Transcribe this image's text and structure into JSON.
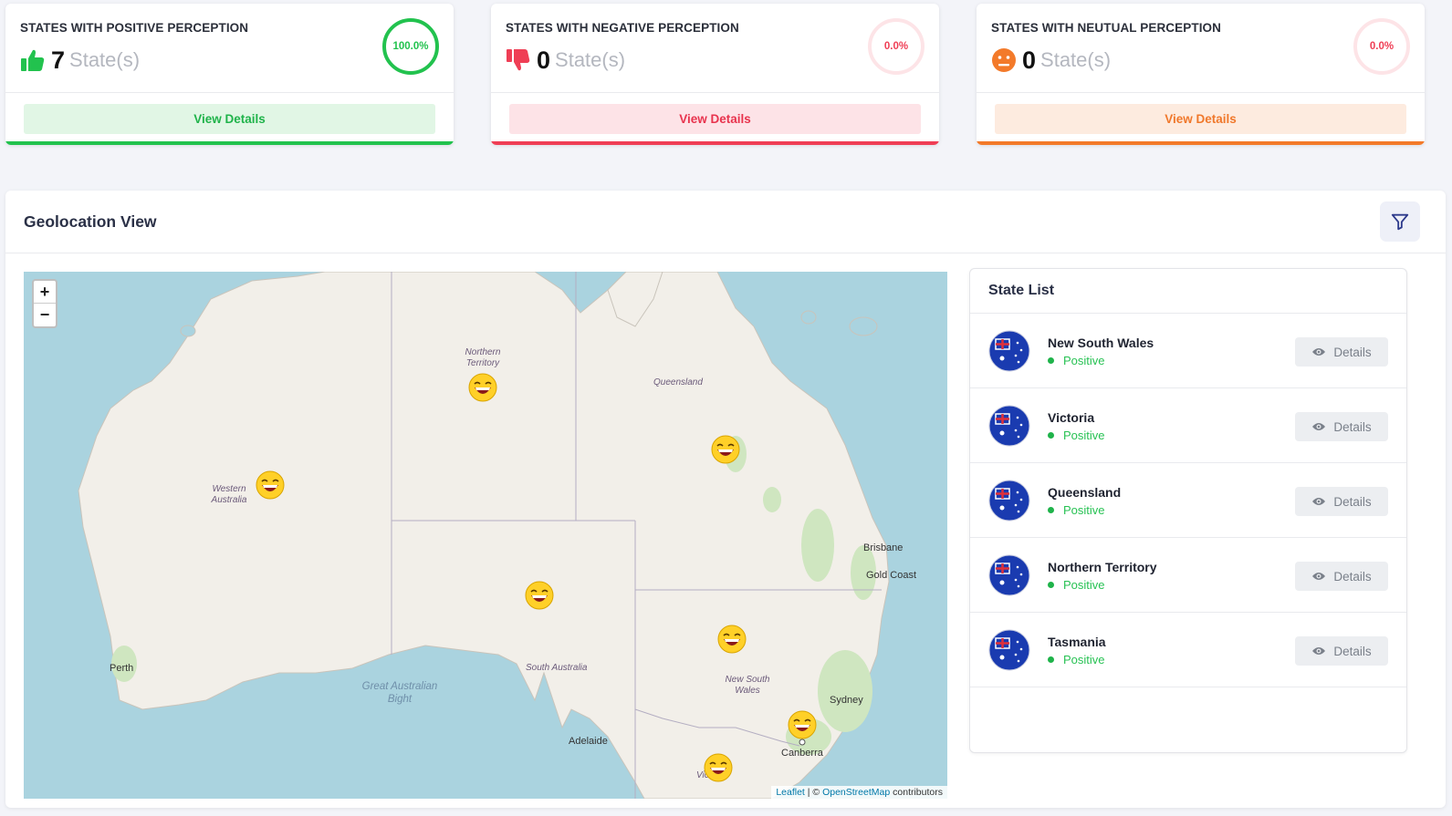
{
  "cards": [
    {
      "title": "STATES WITH POSITIVE PERCEPTION",
      "count": "7",
      "unit": "State(s)",
      "percent": "100.0%",
      "percent_value": 100,
      "button": "View Details",
      "icon": "thumbs-up-icon",
      "color": "#22c24e"
    },
    {
      "title": "STATES WITH NEGATIVE PERCEPTION",
      "count": "0",
      "unit": "State(s)",
      "percent": "0.0%",
      "percent_value": 0,
      "button": "View Details",
      "icon": "thumbs-down-icon",
      "color": "#ef3e55"
    },
    {
      "title": "STATES WITH NEUTUAL PERCEPTION",
      "count": "0",
      "unit": "State(s)",
      "percent": "0.0%",
      "percent_value": 0,
      "button": "View Details",
      "icon": "neutral-face-icon",
      "color": "#f37a2a"
    }
  ],
  "geo": {
    "title": "Geolocation View",
    "filter_icon": "filter-icon",
    "map": {
      "zoom_in": "+",
      "zoom_out": "−",
      "regions": {
        "nt": "Northern Territory",
        "qld": "Queensland",
        "wa": "Western Australia",
        "sa": "South Australia",
        "nsw": "New South Wales",
        "vic": "Vic"
      },
      "cities": {
        "brisbane": "Brisbane",
        "gold_coast": "Gold Coast",
        "perth": "Perth",
        "adelaide": "Adelaide",
        "sydney": "Sydney",
        "canberra": "Canberra"
      },
      "sea": "Great Australian Bight",
      "marker_icon": "laughing-smiley-icon",
      "attribution": {
        "leaflet": "Leaflet",
        "sep": " | © ",
        "osm": "OpenStreetMap",
        "rest": " contributors"
      }
    },
    "state_list": {
      "title": "State List",
      "items": [
        {
          "name": "New South Wales",
          "status": "Positive",
          "button": "Details"
        },
        {
          "name": "Victoria",
          "status": "Positive",
          "button": "Details"
        },
        {
          "name": "Queensland",
          "status": "Positive",
          "button": "Details"
        },
        {
          "name": "Northern Territory",
          "status": "Positive",
          "button": "Details"
        },
        {
          "name": "Tasmania",
          "status": "Positive",
          "button": "Details"
        }
      ]
    }
  }
}
